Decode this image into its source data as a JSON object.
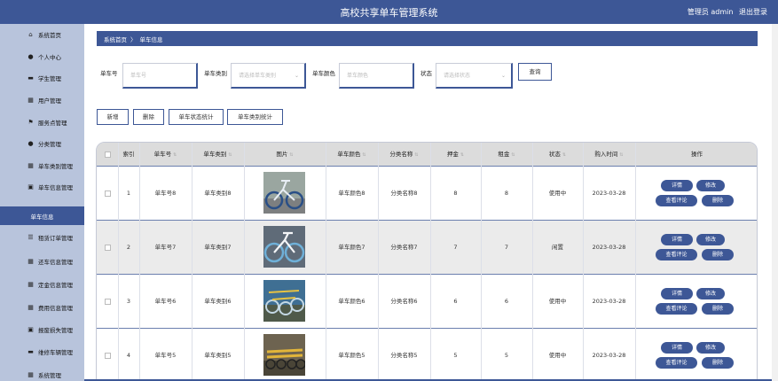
{
  "header": {
    "title": "高校共享单车管理系统",
    "admin_label": "管理员 admin",
    "logout_label": "退出登录"
  },
  "sidebar": {
    "items": [
      {
        "label": "系统首页",
        "icon": "home-icon",
        "glyph": "⌂"
      },
      {
        "label": "个人中心",
        "icon": "user-icon",
        "glyph": "●"
      },
      {
        "label": "学生管理",
        "icon": "student-icon",
        "glyph": "▬"
      },
      {
        "label": "用户管理",
        "icon": "users-icon",
        "glyph": "▦"
      },
      {
        "label": "服务点管理",
        "icon": "flag-icon",
        "glyph": "⚑"
      },
      {
        "label": "分类管理",
        "icon": "location-icon",
        "glyph": "●"
      },
      {
        "label": "单车类别管理",
        "icon": "grid-icon",
        "glyph": "▦"
      },
      {
        "label": "单车信息管理",
        "icon": "briefcase-icon",
        "glyph": "▣"
      },
      {
        "label": "单车信息",
        "icon": "",
        "glyph": "",
        "active": true
      },
      {
        "label": "租赁订单管理",
        "icon": "list-icon",
        "glyph": "☰"
      },
      {
        "label": "还车信息管理",
        "icon": "grid-icon",
        "glyph": "▦"
      },
      {
        "label": "定金信息管理",
        "icon": "grid-icon",
        "glyph": "▦"
      },
      {
        "label": "费用信息管理",
        "icon": "grid-icon",
        "glyph": "▦"
      },
      {
        "label": "报废损失管理",
        "icon": "bus-icon",
        "glyph": "▣"
      },
      {
        "label": "维修车辆管理",
        "icon": "car-icon",
        "glyph": "▬"
      },
      {
        "label": "系统管理",
        "icon": "grid-icon",
        "glyph": "▦"
      }
    ]
  },
  "breadcrumb": {
    "home": "系统首页",
    "separator": "〉",
    "current": "单车信息"
  },
  "filters": {
    "bike_no": {
      "label": "单车号",
      "placeholder": "单车号"
    },
    "bike_type": {
      "label": "单车类别",
      "placeholder": "请选择单车类别"
    },
    "bike_color": {
      "label": "单车颜色",
      "placeholder": "单车颜色"
    },
    "status": {
      "label": "状态",
      "placeholder": "请选择状态"
    },
    "search_label": "查询"
  },
  "actions": {
    "add": "新增",
    "delete": "删除",
    "status_stats": "单车状态统计",
    "type_stats": "单车类别统计"
  },
  "table": {
    "headers": [
      "索引",
      "单车号",
      "单车类别",
      "图片",
      "单车颜色",
      "分类名称",
      "押金",
      "租金",
      "状态",
      "购入时间",
      "操作"
    ],
    "rows": [
      {
        "index": "1",
        "bike_no": "单车号8",
        "type": "单车类别8",
        "color": "单车颜色8",
        "category": "分类名称8",
        "deposit": "8",
        "rent": "8",
        "status": "使用中",
        "date": "2023-03-28",
        "image": "bike-photo-1"
      },
      {
        "index": "2",
        "bike_no": "单车号7",
        "type": "单车类别7",
        "color": "单车颜色7",
        "category": "分类名称7",
        "deposit": "7",
        "rent": "7",
        "status": "闲置",
        "date": "2023-03-28",
        "image": "bike-photo-2"
      },
      {
        "index": "3",
        "bike_no": "单车号6",
        "type": "单车类别6",
        "color": "单车颜色6",
        "category": "分类名称6",
        "deposit": "6",
        "rent": "6",
        "status": "使用中",
        "date": "2023-03-28",
        "image": "bike-photo-3"
      },
      {
        "index": "4",
        "bike_no": "单车号5",
        "type": "单车类别5",
        "color": "单车颜色5",
        "category": "分类名称5",
        "deposit": "5",
        "rent": "5",
        "status": "使用中",
        "date": "2023-03-28",
        "image": "bike-photo-4"
      }
    ],
    "ops": {
      "detail": "详情",
      "edit": "修改",
      "reviews": "查看评论",
      "delete": "删除"
    }
  },
  "colors": {
    "primary": "#3d5796",
    "sidebar": "#b8c4dc",
    "header_row": "#dcdcdc"
  }
}
